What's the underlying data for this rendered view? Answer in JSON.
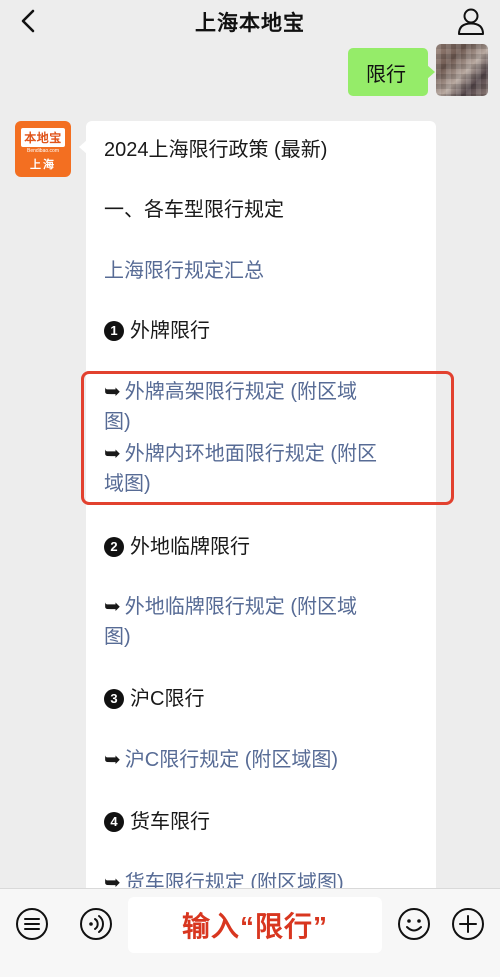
{
  "header": {
    "title": "上海本地宝"
  },
  "messages": {
    "outgoing_text": "限行",
    "bot_avatar": {
      "logo_text": "本地宝",
      "logo_url": "Bendibao.com",
      "city": "上海"
    },
    "card": {
      "title": "2024上海限行政策 (最新)",
      "section_heading": "一、各车型限行规定",
      "summary_link": "上海限行规定汇总",
      "items": [
        {
          "num": "1",
          "label": "外牌限行"
        },
        {
          "num": "2",
          "label": "外地临牌限行"
        },
        {
          "num": "3",
          "label": "沪C限行"
        },
        {
          "num": "4",
          "label": "货车限行"
        }
      ],
      "links": {
        "waipai_gaojia_line1": "外牌高架限行规定 (附区域",
        "waipai_gaojia_line2": "图)",
        "waipai_neihuan_line1": "外牌内环地面限行规定 (附区",
        "waipai_neihuan_line2": "域图)",
        "linpai_line1": "外地临牌限行规定 (附区域",
        "linpai_line2": "图)",
        "huc": "沪C限行规定 (附区域图)",
        "huoche": "货车限行规定 (附区域图)"
      },
      "arrow_symbol": "➥"
    }
  },
  "input_bar": {
    "input_text": "输入“限行”"
  },
  "colors": {
    "background": "#ededed",
    "bubble_green": "#95ec69",
    "link_blue": "#576b95",
    "highlight_red": "#e2412f",
    "input_text_red": "#d8361f",
    "logo_orange": "#f36f21"
  },
  "icons": {
    "back": "chevron-left-icon",
    "profile": "user-icon",
    "menu": "menu-list-icon",
    "voice": "voice-icon",
    "emoji": "emoji-icon",
    "add": "plus-circle-icon"
  }
}
